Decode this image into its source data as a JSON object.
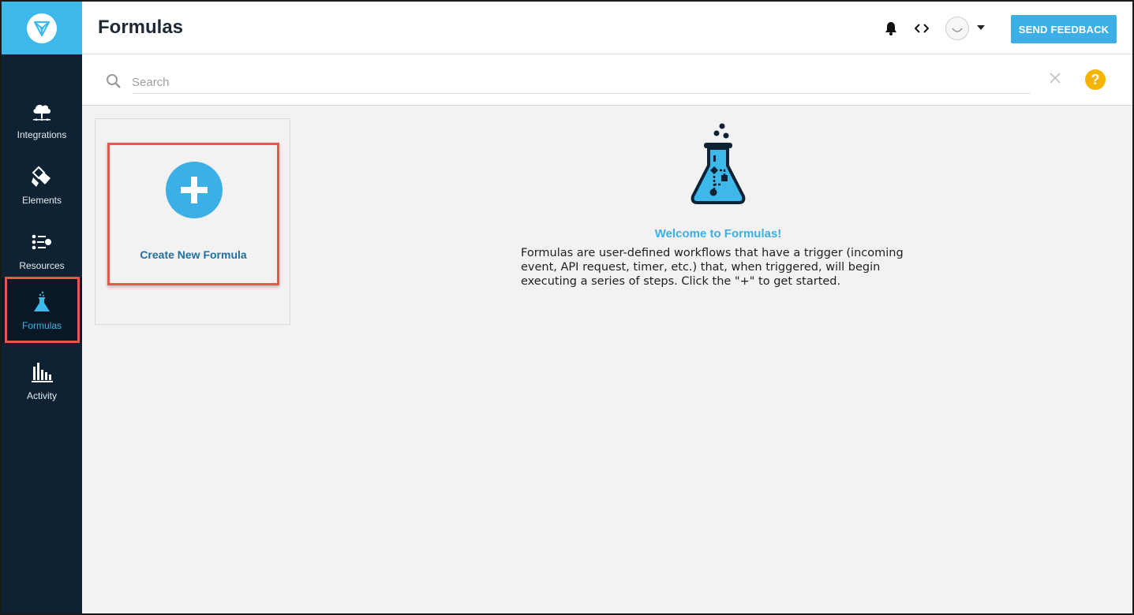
{
  "header": {
    "title": "Formulas",
    "feedback_label": "SEND FEEDBACK",
    "icons": [
      "bell-icon",
      "code-icon",
      "avatar",
      "chevron-down-icon"
    ]
  },
  "sidebar": {
    "items": [
      {
        "label": "Integrations",
        "icon": "cloud-network-icon",
        "active": false
      },
      {
        "label": "Elements",
        "icon": "elements-icon",
        "active": false
      },
      {
        "label": "Resources",
        "icon": "resources-icon",
        "active": false
      },
      {
        "label": "Formulas",
        "icon": "flask-icon",
        "active": true
      },
      {
        "label": "Activity",
        "icon": "bar-chart-icon",
        "active": false
      }
    ]
  },
  "search": {
    "placeholder": "Search",
    "value": ""
  },
  "main": {
    "create_label": "Create New Formula",
    "welcome_title": "Welcome to Formulas!",
    "welcome_text": "Formulas are user-defined workflows that have a trigger (incoming event, API request, timer, etc.) that, when triggered, will begin executing a series of steps. Click the \"+\" to get started."
  },
  "colors": {
    "accent": "#3cb0e6",
    "sidebar_bg": "#0f2233",
    "highlight": "#e8574a",
    "help": "#f4b400",
    "link": "#1f6fa0"
  }
}
